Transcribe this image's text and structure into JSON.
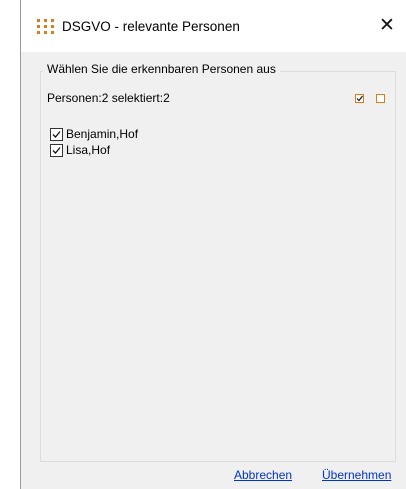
{
  "window": {
    "title": "DSGVO - relevante Personen",
    "close_glyph": "✕",
    "app_icon": "grid-dots-icon",
    "accent_color": "#d97c1e"
  },
  "group": {
    "legend": "Wählen Sie die erkennbaren Personen aus",
    "count_label": "Personen:2 selektiert:2",
    "select_all_icon": "check-all-icon",
    "select_none_icon": "uncheck-all-icon"
  },
  "persons": [
    {
      "label": "Benjamin,Hof",
      "checked": true
    },
    {
      "label": "Lisa,Hof",
      "checked": true
    }
  ],
  "footer": {
    "cancel_label": "Abbrechen",
    "apply_label": "Übernehmen",
    "link_color": "#0033cc"
  }
}
